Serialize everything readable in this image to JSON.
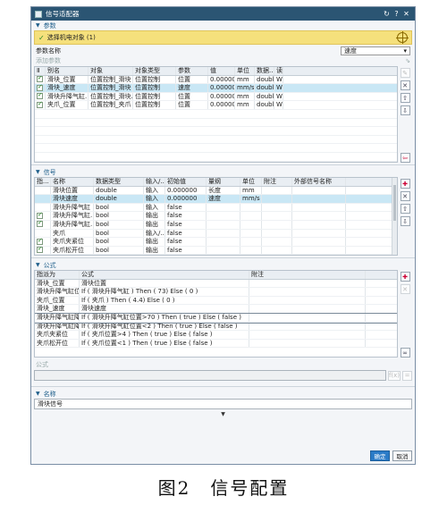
{
  "window": {
    "title": "信号适配器",
    "buttons": [
      "↻",
      "?",
      "✕"
    ]
  },
  "params_section": {
    "title": "参数",
    "selected_object": "选择机电对象 (1)",
    "param_name_label": "参数名称",
    "param_name_value": "速度",
    "add_param_label": "添加参数",
    "columns": [
      "别名",
      "对象",
      "对象类型",
      "参数",
      "值",
      "单位",
      "数据...",
      "读"
    ],
    "rows": [
      {
        "checked": true,
        "c": [
          "滑块_位置",
          "位置控制_滑块",
          "位置控制",
          "位置",
          "0.000000",
          "mm",
          "double",
          "W"
        ]
      },
      {
        "checked": true,
        "c": [
          "滑块_速度",
          "位置控制_滑块",
          "位置控制",
          "速度",
          "0.000000",
          "mm/s",
          "double",
          "W"
        ]
      },
      {
        "checked": true,
        "c": [
          "滑块升降气缸...",
          "位置控制_滑块...",
          "位置控制",
          "位置",
          "0.000000",
          "mm",
          "double",
          "W"
        ]
      },
      {
        "checked": true,
        "c": [
          "夹爪_位置",
          "位置控制_夹爪",
          "位置控制",
          "位置",
          "0.000000",
          "mm",
          "double",
          "W"
        ]
      }
    ]
  },
  "signals_section": {
    "title": "信号",
    "columns": [
      "指...",
      "名称",
      "数据类型",
      "输入/...",
      "初始值",
      "量纲",
      "单位",
      "附注",
      "外部信号名称"
    ],
    "rows": [
      {
        "checked": false,
        "c": [
          "",
          "滑块位置",
          "double",
          "输入",
          "0.000000",
          "长度",
          "mm",
          "",
          ""
        ]
      },
      {
        "checked": false,
        "c": [
          "",
          "滑块速度",
          "double",
          "输入",
          "0.000000",
          "速度",
          "mm/s",
          "",
          ""
        ]
      },
      {
        "checked": false,
        "c": [
          "",
          "滑块升降气缸",
          "bool",
          "输入",
          "false",
          "",
          "",
          "",
          ""
        ]
      },
      {
        "checked": true,
        "c": [
          "",
          "滑块升降气缸...",
          "bool",
          "输出",
          "false",
          "",
          "",
          "",
          ""
        ]
      },
      {
        "checked": true,
        "c": [
          "",
          "滑块升降气缸...",
          "bool",
          "输出",
          "false",
          "",
          "",
          "",
          ""
        ]
      },
      {
        "checked": false,
        "c": [
          "",
          "夹爪",
          "bool",
          "输入/...",
          "false",
          "",
          "",
          "",
          ""
        ]
      },
      {
        "checked": true,
        "c": [
          "",
          "夹爪夹紧位",
          "bool",
          "输出",
          "false",
          "",
          "",
          "",
          ""
        ]
      },
      {
        "checked": true,
        "c": [
          "",
          "夹爪松开位",
          "bool",
          "输出",
          "false",
          "",
          "",
          "",
          ""
        ]
      }
    ]
  },
  "formula_section": {
    "title": "公式",
    "columns": [
      "指派为",
      "公式",
      "附注"
    ],
    "rows": [
      [
        "滑块_位置",
        "滑块位置",
        ""
      ],
      [
        "滑块升降气缸位...",
        "If ( 滑块升降气缸 ) Then ( 73) Else ( 0 )",
        ""
      ],
      [
        "夹爪_位置",
        "If ( 夹爪 ) Then ( 4.4) Else ( 0 )",
        ""
      ],
      [
        "滑块_速度",
        "滑块速度",
        ""
      ],
      [
        "滑块升降气缸降...",
        "If ( 滑块升降气缸位置>70 ) Then ( true ) Else ( false )",
        ""
      ],
      [
        "滑块升降气缸降...",
        "If ( 滑块升降气缸位置<2 ) Then ( true ) Else ( false )",
        ""
      ],
      [
        "夹爪夹紧位",
        "If ( 夹爪位置>4 ) Then ( true ) Else ( false )",
        ""
      ],
      [
        "夹爪松开位",
        "If ( 夹爪位置<1 ) Then ( true ) Else ( false )",
        ""
      ]
    ],
    "formula_label": "公式",
    "formula_buttons": [
      "f(x)",
      "="
    ]
  },
  "name_section": {
    "title": "名称",
    "value": "滑块信号"
  },
  "footer": {
    "ok": "确定",
    "cancel": "取消"
  },
  "caption": "图2　信号配置"
}
